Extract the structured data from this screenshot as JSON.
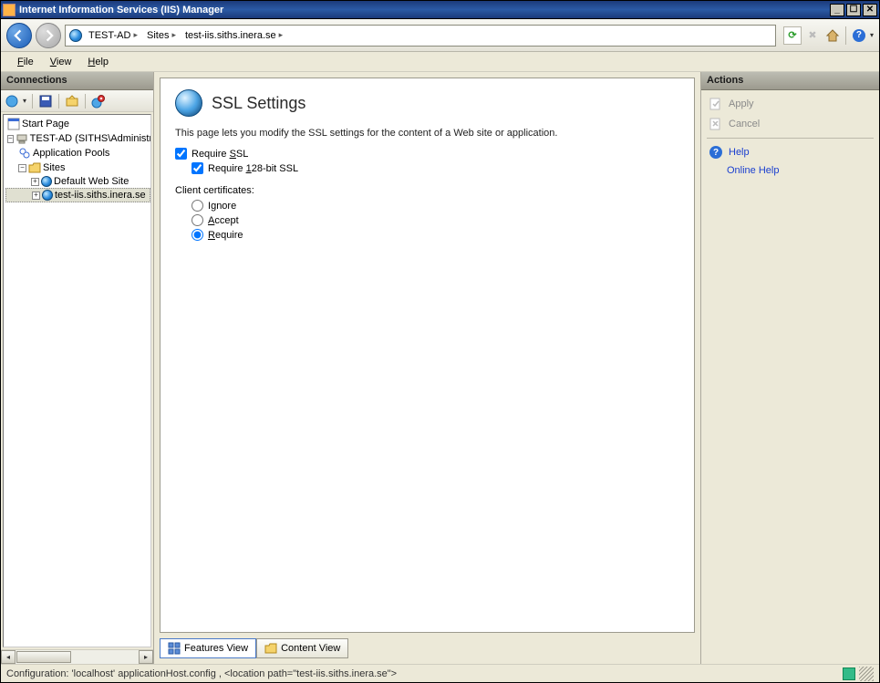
{
  "titlebar": {
    "title": "Internet Information Services (IIS) Manager"
  },
  "breadcrumb": {
    "root": "TEST-AD",
    "sites": "Sites",
    "site": "test-iis.siths.inera.se"
  },
  "menu": {
    "file": "File",
    "view": "View",
    "help": "Help"
  },
  "connections": {
    "header": "Connections",
    "startPage": "Start Page",
    "server": "TEST-AD (SITHS\\Administrator)",
    "appPools": "Application Pools",
    "sites": "Sites",
    "defaultSite": "Default Web Site",
    "selectedSite": "test-iis.siths.inera.se"
  },
  "page": {
    "title": "SSL Settings",
    "description": "This page lets you modify the SSL settings for the content of a Web site or application.",
    "requireSsl": "Require SSL",
    "require128": "Require 128-bit SSL",
    "clientCerts": "Client certificates:",
    "ignore": "Ignore",
    "accept": "Accept",
    "require": "Require"
  },
  "tabs": {
    "features": "Features View",
    "content": "Content View"
  },
  "actions": {
    "header": "Actions",
    "apply": "Apply",
    "cancel": "Cancel",
    "help": "Help",
    "onlineHelp": "Online Help"
  },
  "status": {
    "text": "Configuration: 'localhost' applicationHost.config , <location path=\"test-iis.siths.inera.se\">"
  }
}
